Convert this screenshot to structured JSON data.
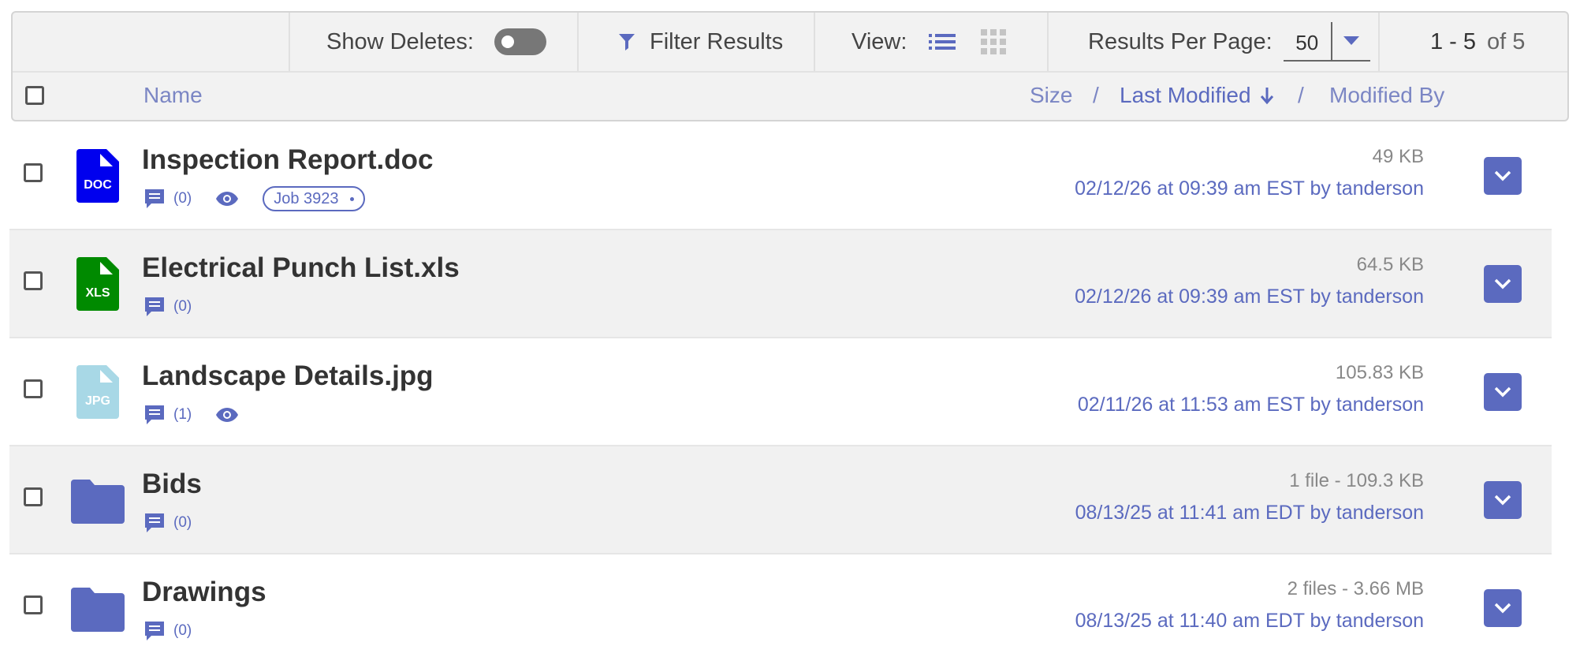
{
  "toolbar": {
    "show_deletes_label": "Show Deletes:",
    "show_deletes_enabled": false,
    "filter_label": "Filter Results",
    "view_label": "View:",
    "view_mode": "list",
    "rpp_label": "Results Per Page:",
    "rpp_value": "50",
    "range_label": "1 - 5",
    "of_label": "of 5"
  },
  "header": {
    "name_label": "Name",
    "size_label": "Size",
    "sep1": "/",
    "last_modified_label": "Last Modified",
    "sep2": "/",
    "modified_by_label": "Modified By"
  },
  "colors": {
    "accent": "#5b6abf",
    "doc": "#0000ee",
    "xls": "#008a00",
    "jpg": "#a8d8e6",
    "folder": "#5b6abf"
  },
  "files": [
    {
      "name": "Inspection Report.doc",
      "type": "DOC",
      "comments": "(0)",
      "size": "49 KB",
      "modified": "02/12/26 at 09:39 am EST by tanderson"
    },
    {
      "name": "Electrical Punch List.xls",
      "type": "XLS",
      "comments": "(0)",
      "size": "64.5 KB",
      "modified": "02/12/26 at 09:39 am EST by tanderson"
    },
    {
      "name": "Landscape Details.jpg",
      "type": "JPG",
      "comments": "(1)",
      "size": "105.83 KB",
      "modified": "02/11/26 at 11:53 am EST by tanderson"
    },
    {
      "name": "Bids",
      "type": "folder",
      "comments": "(0)",
      "size": "1 file - 109.3 KB",
      "modified": "08/13/25 at 11:41 am EDT by tanderson"
    },
    {
      "name": "Drawings",
      "type": "folder",
      "comments": "(0)",
      "size": "2 files - 3.66 MB",
      "modified": "08/13/25 at 11:40 am EDT by tanderson"
    }
  ],
  "tags": {
    "job_tag": "Job 3923"
  }
}
